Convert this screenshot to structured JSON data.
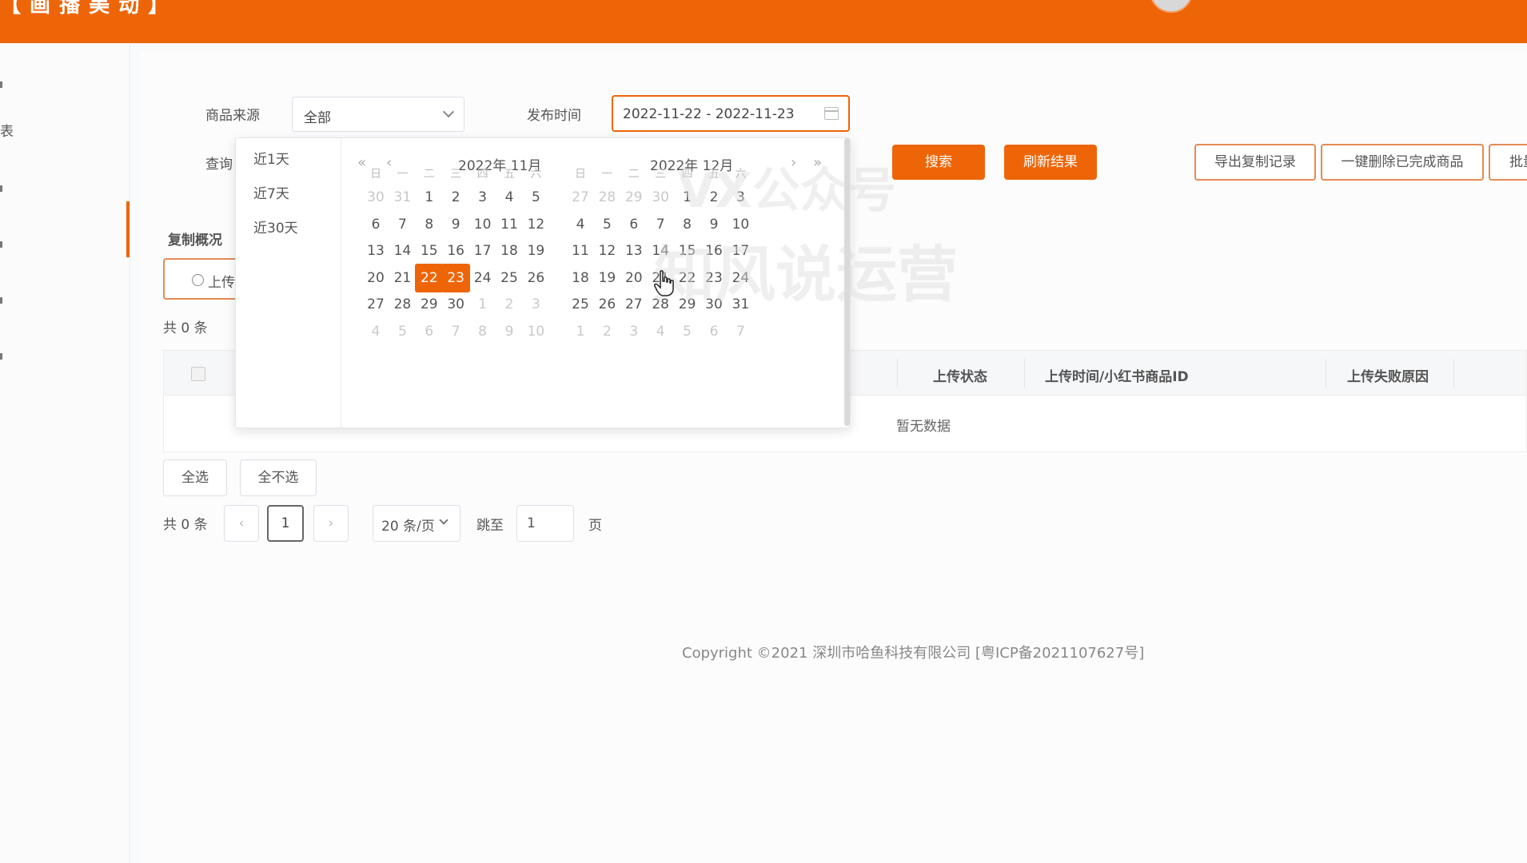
{
  "header": {
    "brand_fragment": "【 画 播 美 动 】"
  },
  "sidebar": {
    "items": [
      {
        "label": ""
      },
      {
        "label": "表"
      },
      {
        "label": ""
      },
      {
        "label": ""
      },
      {
        "label": ""
      },
      {
        "label": ""
      }
    ]
  },
  "filters": {
    "source_label": "商品来源",
    "source_value": "全部",
    "publish_label": "发布时间",
    "date_range": "2022-11-22 - 2022-11-23",
    "query_label": "查询"
  },
  "actions": {
    "search": "搜索",
    "refresh": "刷新结果",
    "export": "导出复制记录",
    "delete_done": "一键删除已完成商品",
    "batch": "批量"
  },
  "overview": {
    "title": "复制概况",
    "chip": "上传",
    "count_top": "共 0 条"
  },
  "table": {
    "columns": [
      "上传状态",
      "上传时间/小红书商品ID",
      "上传失败原因"
    ],
    "empty_text": "暂无数据"
  },
  "bulk": {
    "select_all": "全选",
    "select_none": "全不选"
  },
  "pagination": {
    "total": "共 0 条",
    "prev": "‹",
    "current": "1",
    "next": "›",
    "page_size": "20 条/页",
    "jump_label": "跳至",
    "jump_value": "1",
    "page_suffix": "页"
  },
  "footer": {
    "copyright": "Copyright ©2021 深圳市哈鱼科技有限公司 [粤ICP备2021107627号]"
  },
  "datepicker": {
    "shortcuts": [
      "近1天",
      "近7天",
      "近30天"
    ],
    "nav": {
      "prev_year": "«",
      "prev_month": "‹",
      "next_month": "›",
      "next_year": "»"
    },
    "weekdays": [
      "日",
      "一",
      "二",
      "三",
      "四",
      "五",
      "六"
    ],
    "months": [
      {
        "title": "2022年 11月",
        "weeks": [
          [
            "30",
            "31",
            "1",
            "2",
            "3",
            "4",
            "5"
          ],
          [
            "6",
            "7",
            "8",
            "9",
            "10",
            "11",
            "12"
          ],
          [
            "13",
            "14",
            "15",
            "16",
            "17",
            "18",
            "19"
          ],
          [
            "20",
            "21",
            "22",
            "23",
            "24",
            "25",
            "26"
          ],
          [
            "27",
            "28",
            "29",
            "30",
            "1",
            "2",
            "3"
          ],
          [
            "4",
            "5",
            "6",
            "7",
            "8",
            "9",
            "10"
          ]
        ],
        "muted": [
          [
            0,
            0
          ],
          [
            0,
            1
          ],
          [
            4,
            4
          ],
          [
            4,
            5
          ],
          [
            4,
            6
          ],
          [
            5,
            0
          ],
          [
            5,
            1
          ],
          [
            5,
            2
          ],
          [
            5,
            3
          ],
          [
            5,
            4
          ],
          [
            5,
            5
          ],
          [
            5,
            6
          ]
        ],
        "selected": [
          [
            3,
            2
          ],
          [
            3,
            3
          ]
        ]
      },
      {
        "title": "2022年 12月",
        "weeks": [
          [
            "27",
            "28",
            "29",
            "30",
            "1",
            "2",
            "3"
          ],
          [
            "4",
            "5",
            "6",
            "7",
            "8",
            "9",
            "10"
          ],
          [
            "11",
            "12",
            "13",
            "14",
            "15",
            "16",
            "17"
          ],
          [
            "18",
            "19",
            "20",
            "21",
            "22",
            "23",
            "24"
          ],
          [
            "25",
            "26",
            "27",
            "28",
            "29",
            "30",
            "31"
          ],
          [
            "1",
            "2",
            "3",
            "4",
            "5",
            "6",
            "7"
          ]
        ],
        "muted": [
          [
            0,
            0
          ],
          [
            0,
            1
          ],
          [
            0,
            2
          ],
          [
            0,
            3
          ],
          [
            5,
            0
          ],
          [
            5,
            1
          ],
          [
            5,
            2
          ],
          [
            5,
            3
          ],
          [
            5,
            4
          ],
          [
            5,
            5
          ],
          [
            5,
            6
          ]
        ],
        "selected": []
      }
    ]
  },
  "watermark": {
    "line1": "VX公众号",
    "line2": "知风说运营"
  },
  "colors": {
    "accent": "#ee6508",
    "border_accent": "#e38a55"
  }
}
